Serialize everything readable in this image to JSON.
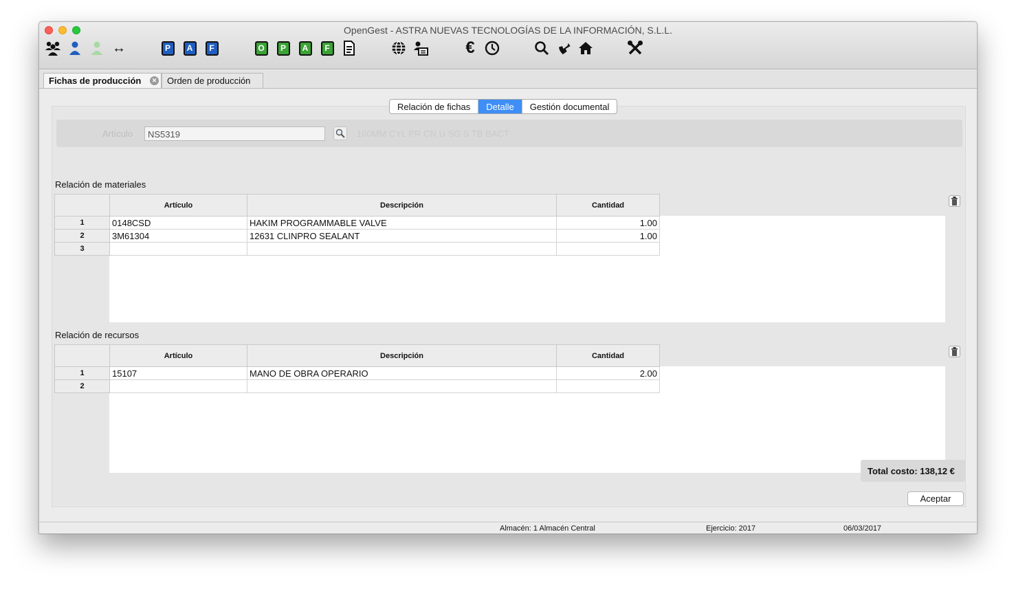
{
  "window": {
    "title": "OpenGest - ASTRA NUEVAS TECNOLOGÍAS DE LA INFORMACIÓN, S.L.L."
  },
  "toolbar": {
    "icons": [
      "users-group-icon",
      "user-blue-icon",
      "user-green-icon",
      "arrows-horizontal-icon",
      "doc-p-blue-icon",
      "doc-a-blue-icon",
      "doc-f-blue-icon",
      "doc-o-green-icon",
      "doc-p-green-icon",
      "doc-a-green-icon",
      "doc-f-green-icon",
      "document-list-icon",
      "globe-icon",
      "person-card-icon",
      "euro-icon",
      "clock-icon",
      "search-icon",
      "phone-icon",
      "home-icon",
      "tools-icon"
    ],
    "letters": {
      "p": "P",
      "a": "A",
      "f": "F",
      "o": "O"
    },
    "glyphs": {
      "euro": "€",
      "arrows": "↔"
    },
    "colors": {
      "blue": "#1f5fbf",
      "green": "#3aa335"
    }
  },
  "doc_tabs": [
    {
      "label": "Fichas de producción"
    },
    {
      "label": "Orden de producción"
    }
  ],
  "view_tabs": [
    {
      "label": "Relación de fichas"
    },
    {
      "label": "Detalle"
    },
    {
      "label": "Gestión documental"
    }
  ],
  "accent_color": "#3e8ef7",
  "article": {
    "label": "Artículo",
    "value": "NS5319",
    "description": "100MM CYL PR CN U SG S TB BACT"
  },
  "materials": {
    "title": "Relación de materiales",
    "columns": [
      "Artículo",
      "Descripción",
      "Cantidad"
    ],
    "rows": [
      {
        "n": "1",
        "articulo": "0148CSD",
        "descripcion": "HAKIM PROGRAMMABLE VALVE",
        "cantidad": "1.00"
      },
      {
        "n": "2",
        "articulo": "3M61304",
        "descripcion": "12631 CLINPRO SEALANT",
        "cantidad": "1.00"
      },
      {
        "n": "3",
        "articulo": "",
        "descripcion": "",
        "cantidad": ""
      }
    ]
  },
  "resources": {
    "title": "Relación de recursos",
    "columns": [
      "Artículo",
      "Descripción",
      "Cantidad"
    ],
    "rows": [
      {
        "n": "1",
        "articulo": "15107",
        "descripcion": "MANO DE OBRA OPERARIO",
        "cantidad": "2.00"
      },
      {
        "n": "2",
        "articulo": "",
        "descripcion": "",
        "cantidad": ""
      }
    ]
  },
  "total": "Total costo: 138,12 €",
  "accept_label": "Aceptar",
  "status": {
    "almacen": "Almacén: 1 Almacén Central",
    "ejercicio": "Ejercicio: 2017",
    "fecha": "06/03/2017"
  }
}
